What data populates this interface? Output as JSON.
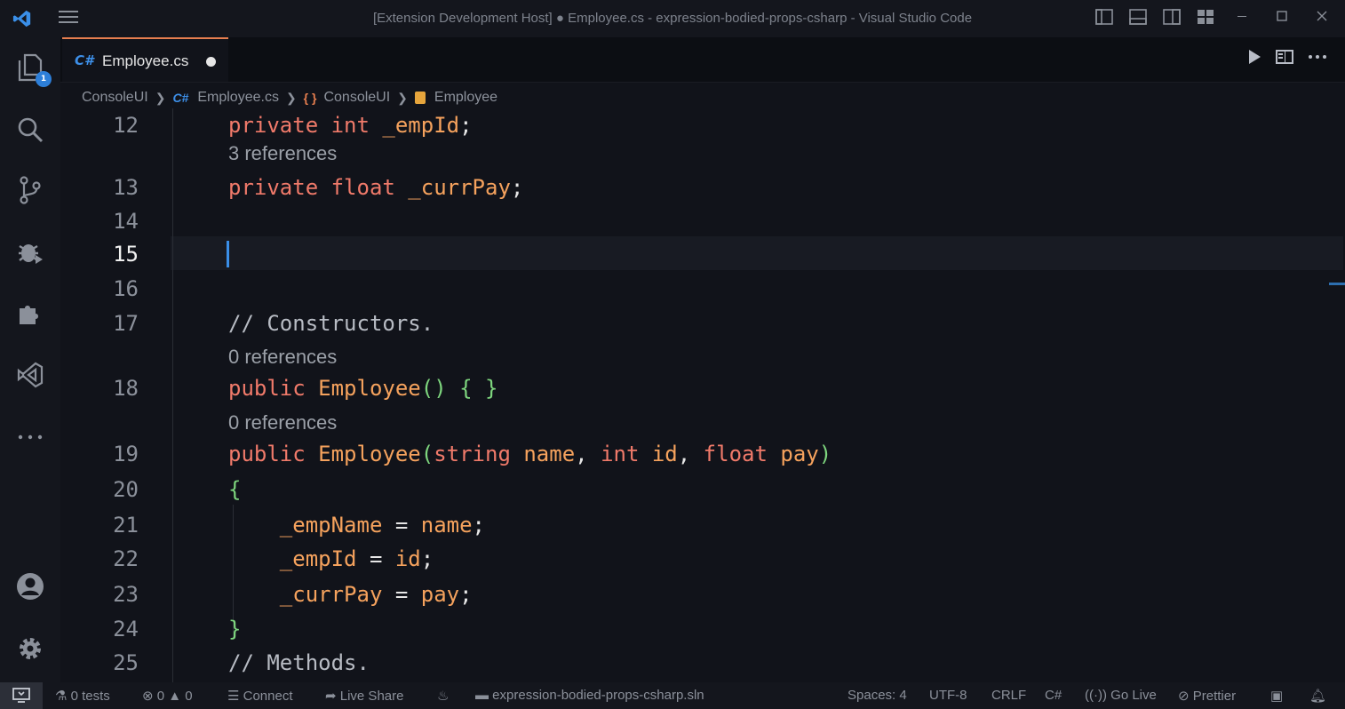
{
  "window": {
    "title": "[Extension Development Host] ● Employee.cs - expression-bodied-props-csharp - Visual Studio Code"
  },
  "activity": {
    "explorer_badge": "1"
  },
  "tab": {
    "lang": "C#",
    "filename": "Employee.cs"
  },
  "breadcrumb": {
    "project": "ConsoleUI",
    "lang": "C#",
    "file": "Employee.cs",
    "namespace_icon": "{ }",
    "namespace": "ConsoleUI",
    "class": "Employee"
  },
  "code": {
    "lines": [
      {
        "num": "12",
        "parts": [
          [
            "kw",
            "private "
          ],
          [
            "kw",
            "int "
          ],
          [
            "fn",
            "_empId"
          ],
          [
            "",
            "; "
          ]
        ]
      },
      {
        "lens": "3 references"
      },
      {
        "num": "13",
        "parts": [
          [
            "kw",
            "private "
          ],
          [
            "kw",
            "float "
          ],
          [
            "fn",
            "_currPay"
          ],
          [
            "",
            ";"
          ]
        ]
      },
      {
        "num": "14",
        "parts": []
      },
      {
        "num": "15",
        "parts": []
      },
      {
        "num": "16",
        "parts": []
      },
      {
        "num": "17",
        "parts": [
          [
            "cm",
            "// Constructors."
          ]
        ]
      },
      {
        "lens": "0 references"
      },
      {
        "num": "18",
        "parts": [
          [
            "kw",
            "public "
          ],
          [
            "fn",
            "Employee"
          ],
          [
            "br",
            "() { }"
          ]
        ]
      },
      {
        "lens": "0 references"
      },
      {
        "num": "19",
        "parts": [
          [
            "kw",
            "public "
          ],
          [
            "fn",
            "Employee"
          ],
          [
            "br",
            "("
          ],
          [
            "kw",
            "string "
          ],
          [
            "fn",
            "name"
          ],
          [
            "",
            ", "
          ],
          [
            "kw",
            "int "
          ],
          [
            "fn",
            "id"
          ],
          [
            "",
            ", "
          ],
          [
            "kw",
            "float "
          ],
          [
            "fn",
            "pay"
          ],
          [
            "br",
            ")"
          ]
        ]
      },
      {
        "num": "20",
        "parts": [
          [
            "br",
            "{"
          ]
        ]
      },
      {
        "num": "21",
        "parts": [
          [
            "",
            "    "
          ],
          [
            "fn",
            "_empName"
          ],
          [
            "",
            " = "
          ],
          [
            "fn",
            "name"
          ],
          [
            "",
            ";"
          ]
        ]
      },
      {
        "num": "22",
        "parts": [
          [
            "",
            "    "
          ],
          [
            "fn",
            "_empId"
          ],
          [
            "",
            " = "
          ],
          [
            "fn",
            "id"
          ],
          [
            "",
            ";"
          ]
        ]
      },
      {
        "num": "23",
        "parts": [
          [
            "",
            "    "
          ],
          [
            "fn",
            "_currPay"
          ],
          [
            "",
            " = "
          ],
          [
            "fn",
            "pay"
          ],
          [
            "",
            ";"
          ]
        ]
      },
      {
        "num": "24",
        "parts": [
          [
            "br",
            "}"
          ]
        ]
      },
      {
        "num": "25",
        "parts": [
          [
            "cm",
            "// Methods."
          ]
        ]
      }
    ],
    "active_line": "15"
  },
  "status": {
    "tests": "0 tests",
    "errors": "0",
    "warnings": "0",
    "connect": "Connect",
    "live_share": "Live Share",
    "solution": "expression-bodied-props-csharp.sln",
    "spaces": "Spaces: 4",
    "encoding": "UTF-8",
    "eol": "CRLF",
    "language": "C#",
    "go_live": "Go Live",
    "prettier": "Prettier"
  }
}
